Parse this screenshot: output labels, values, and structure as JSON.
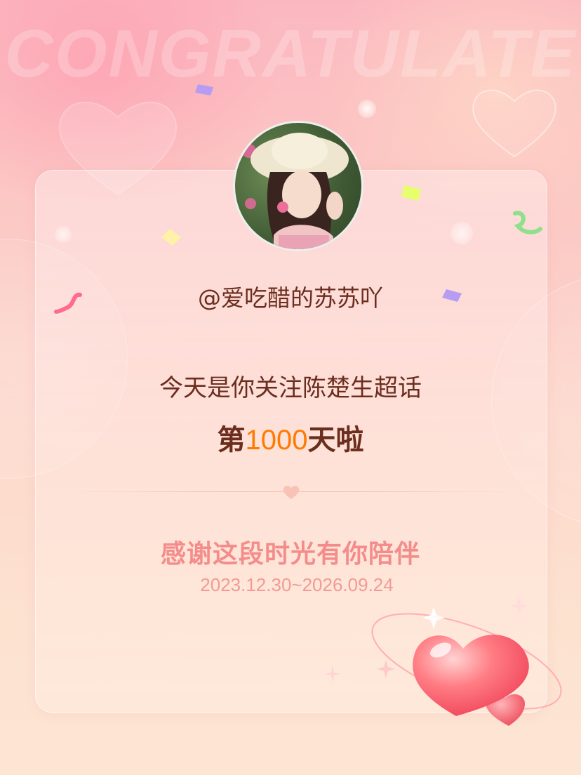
{
  "background": {
    "word": "CONGRATULATE"
  },
  "user": {
    "handle": "@爱吃醋的苏苏吖"
  },
  "message": {
    "line1": "今天是你关注陈楚生超话",
    "line2_prefix": "第",
    "day_count": "1000",
    "line2_suffix": "天啦"
  },
  "footer": {
    "thanks": "感谢这段时光有你陪伴",
    "date_range": "2023.12.30~2026.09.24"
  },
  "colors": {
    "brand_text": "#6b2d1e",
    "accent_number": "#ff7a00",
    "thanks_pink": "#f58c8c"
  },
  "icons": {
    "avatar": "user-avatar",
    "divider": "heart-icon",
    "decoration": "big-heart-icon"
  }
}
